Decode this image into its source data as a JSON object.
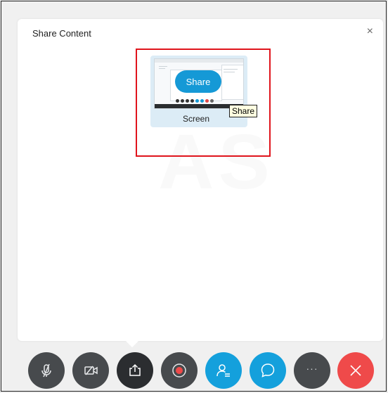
{
  "dialog": {
    "title": "Share Content",
    "close_label": "×"
  },
  "share_option": {
    "share_button_label": "Share",
    "label": "Screen",
    "tooltip": "Share"
  },
  "watermark": "AS",
  "toolbar": {
    "buttons": [
      {
        "name": "mute",
        "icon": "microphone-off-icon",
        "color": "#474a4d"
      },
      {
        "name": "video",
        "icon": "video-off-icon",
        "color": "#474a4d"
      },
      {
        "name": "share",
        "icon": "share-icon",
        "color": "#2b2d30"
      },
      {
        "name": "record",
        "icon": "record-icon",
        "color": "#474a4d"
      },
      {
        "name": "participants",
        "icon": "participants-icon",
        "color": "#14a0dc"
      },
      {
        "name": "chat",
        "icon": "chat-icon",
        "color": "#14a0dc"
      },
      {
        "name": "more",
        "icon": "more-icon",
        "label": "···",
        "color": "#474a4d"
      },
      {
        "name": "leave",
        "icon": "close-icon",
        "color": "#ef4a4a"
      }
    ]
  },
  "colors": {
    "accent": "#14a0dc",
    "highlight_border": "#e0141c",
    "leave": "#ef4a4a"
  }
}
